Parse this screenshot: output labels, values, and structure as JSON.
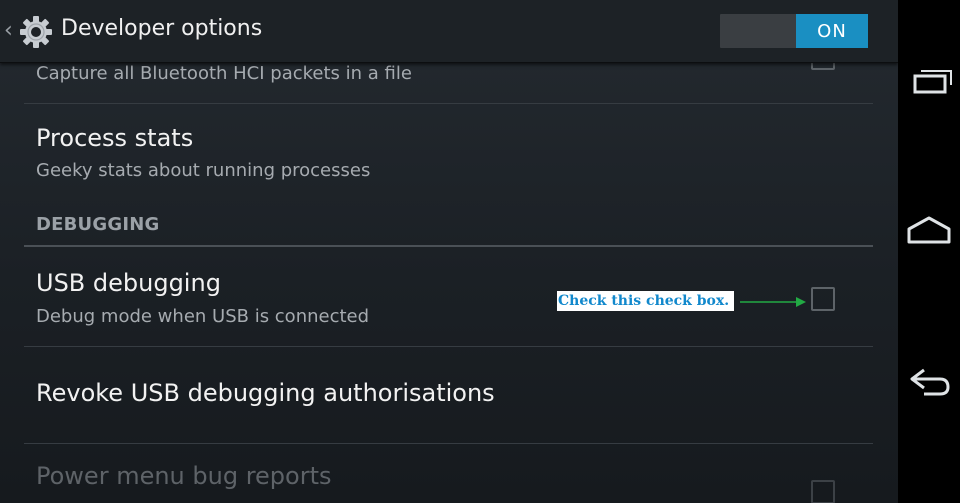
{
  "action_bar": {
    "title": "Developer options",
    "switch_label": "ON"
  },
  "prefs": {
    "bluetooth_hci": {
      "summary": "Capture all Bluetooth HCI packets in a file"
    },
    "process_stats": {
      "title": "Process stats",
      "summary": "Geeky stats about running processes"
    },
    "section_debugging": "DEBUGGING",
    "usb_debugging": {
      "title": "USB debugging",
      "summary": "Debug mode when USB is connected"
    },
    "revoke": {
      "title": "Revoke USB debugging authorisations"
    },
    "power_menu": {
      "title": "Power menu bug reports"
    }
  },
  "annotation": {
    "callout_text": "Check this check box.",
    "callout_color": "#1188cc",
    "arrow_color": "#22aa44"
  },
  "colors": {
    "accent": "#1a8fc2",
    "background": "#1b2025",
    "title_text": "#f2f2f2",
    "summary_text": "#a6abb0"
  },
  "icons": {
    "app_icon": "gear-icon",
    "nav": [
      "recent-apps-icon",
      "home-icon",
      "back-icon"
    ]
  }
}
